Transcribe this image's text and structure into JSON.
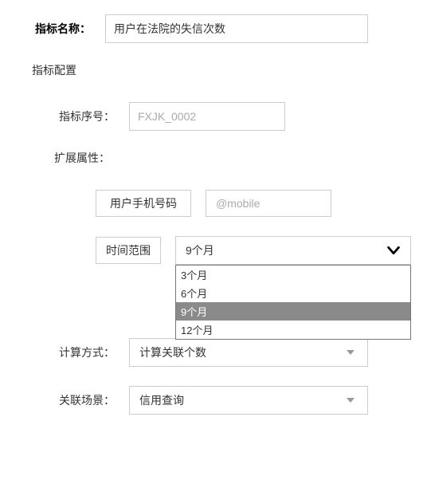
{
  "header": {
    "name_label": "指标名称：",
    "name_value": "用户在法院的失信次数"
  },
  "config": {
    "section_title": "指标配置",
    "serial": {
      "label": "指标序号：",
      "placeholder": "FXJK_0002",
      "value": ""
    },
    "ext_attr_label": "扩展属性：",
    "phone": {
      "label": "用户手机号码",
      "placeholder": "@mobile"
    },
    "time_range": {
      "label": "时间范围",
      "value": "9个月",
      "options": [
        "3个月",
        "6个月",
        "9个月",
        "12个月"
      ]
    },
    "calc": {
      "label": "计算方式：",
      "value": "计算关联个数"
    },
    "scene": {
      "label": "关联场景：",
      "value": "信用查询"
    }
  }
}
